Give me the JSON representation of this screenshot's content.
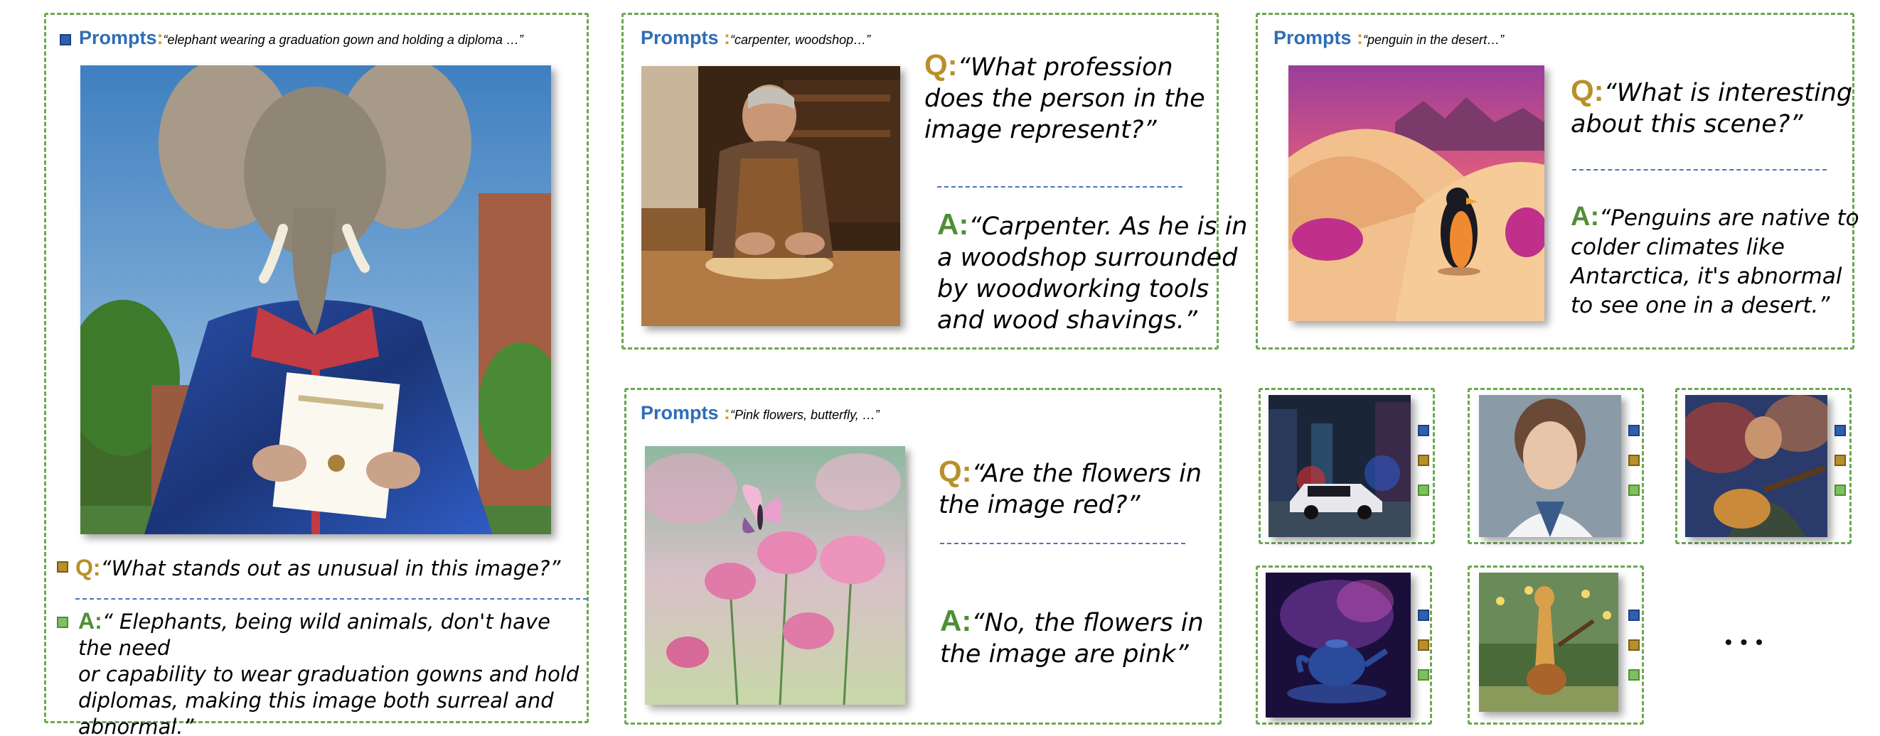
{
  "panel_elephant": {
    "prompt_label": "Prompts",
    "prompt_colon": ":",
    "prompt_text": "“elephant wearing a graduation gown and holding a diploma …”",
    "q_label": "Q:",
    "question": "“What stands out as unusual in this image?”",
    "a_label": "A:",
    "answer_lines": [
      "“ Elephants, being wild animals, don't have the need",
      "or capability to wear graduation gowns and hold",
      "diplomas, making this image both surreal and",
      "abnormal.”"
    ]
  },
  "panel_carpenter": {
    "prompt_label": "Prompts",
    "prompt_colon": " :",
    "prompt_text": "“carpenter, woodshop…”",
    "q_label": "Q:",
    "question_lines": [
      "“What profession",
      "does the person in the",
      "image represent?”"
    ],
    "a_label": "A:",
    "answer_lines": [
      "“Carpenter. As he is in",
      "a woodshop surrounded",
      "by woodworking tools",
      "and wood shavings.”"
    ]
  },
  "panel_penguin": {
    "prompt_label": "Prompts",
    "prompt_colon": " :",
    "prompt_text": "“penguin in the desert…”",
    "q_label": "Q:",
    "question_lines": [
      "“What is interesting",
      "about this scene?”"
    ],
    "a_label": "A:",
    "answer_lines": [
      "“Penguins are native to",
      "colder climates like",
      "Antarctica, it's abnormal",
      "to see one in a desert.”"
    ]
  },
  "panel_flowers": {
    "prompt_label": "Prompts",
    "prompt_colon": " :",
    "prompt_text": "“Pink flowers, butterfly, …”",
    "q_label": "Q:",
    "question_lines": [
      "“Are the flowers in",
      "the image red?”"
    ],
    "a_label": "A:",
    "answer_lines": [
      "“No, the flowers in",
      "the image are pink”"
    ]
  },
  "ellipsis": "• • •",
  "colors": {
    "prompt_blue": "#2e6db4",
    "question_gold": "#b8902a",
    "answer_green": "#4f8f34",
    "border_green": "#6aa84f",
    "separator_blue": "#4a73c4"
  },
  "thumbnails": [
    "police-car-night-city",
    "female-doctor-portrait",
    "man-playing-guitar",
    "teapot-in-space",
    "giraffe-playing-guitar"
  ]
}
